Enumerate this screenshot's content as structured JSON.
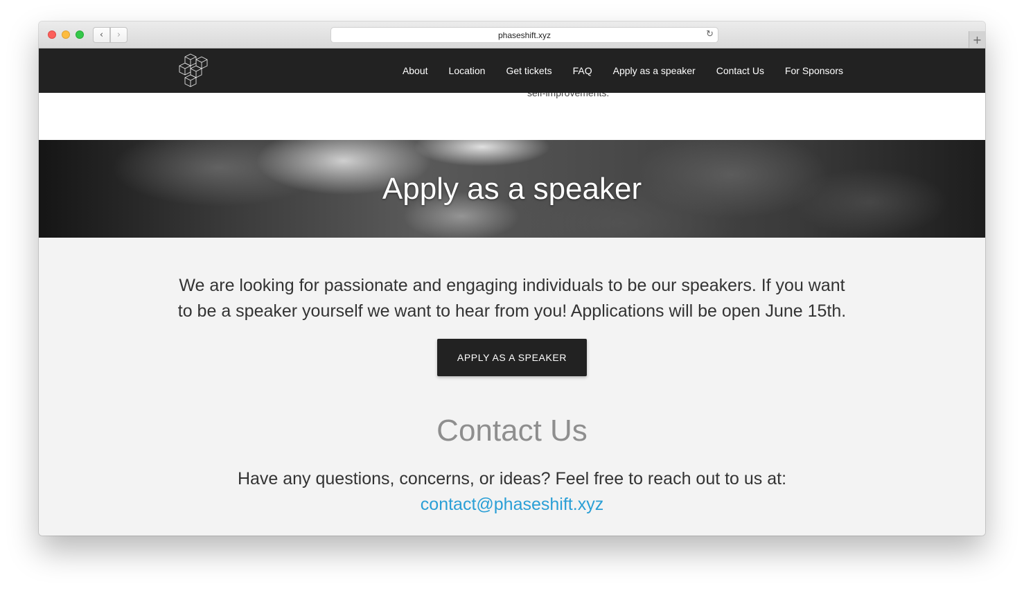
{
  "browser": {
    "url": "phaseshift.xyz",
    "back_icon": "‹",
    "forward_icon": "›",
    "reload_icon": "↻",
    "new_tab_icon": "+"
  },
  "nav": {
    "links": [
      "About",
      "Location",
      "Get tickets",
      "FAQ",
      "Apply as a speaker",
      "Contact Us",
      "For Sponsors"
    ]
  },
  "partial_text": "self-improvements.",
  "hero": {
    "title": "Apply as a speaker"
  },
  "speaker": {
    "description": "We are looking for passionate and engaging individuals to be our speakers. If you want to be a speaker yourself we want to hear from you! Applications will be open June 15th.",
    "button_label": "APPLY AS A SPEAKER"
  },
  "contact": {
    "title": "Contact Us",
    "text": "Have any questions, concerns, or ideas? Feel free to reach out to us at:",
    "email": "contact@phaseshift.xyz"
  },
  "colors": {
    "nav_bg": "#222222",
    "link": "#2a9fd6",
    "heading_gray": "#8e8e8e",
    "page_bg": "#f3f3f3"
  }
}
